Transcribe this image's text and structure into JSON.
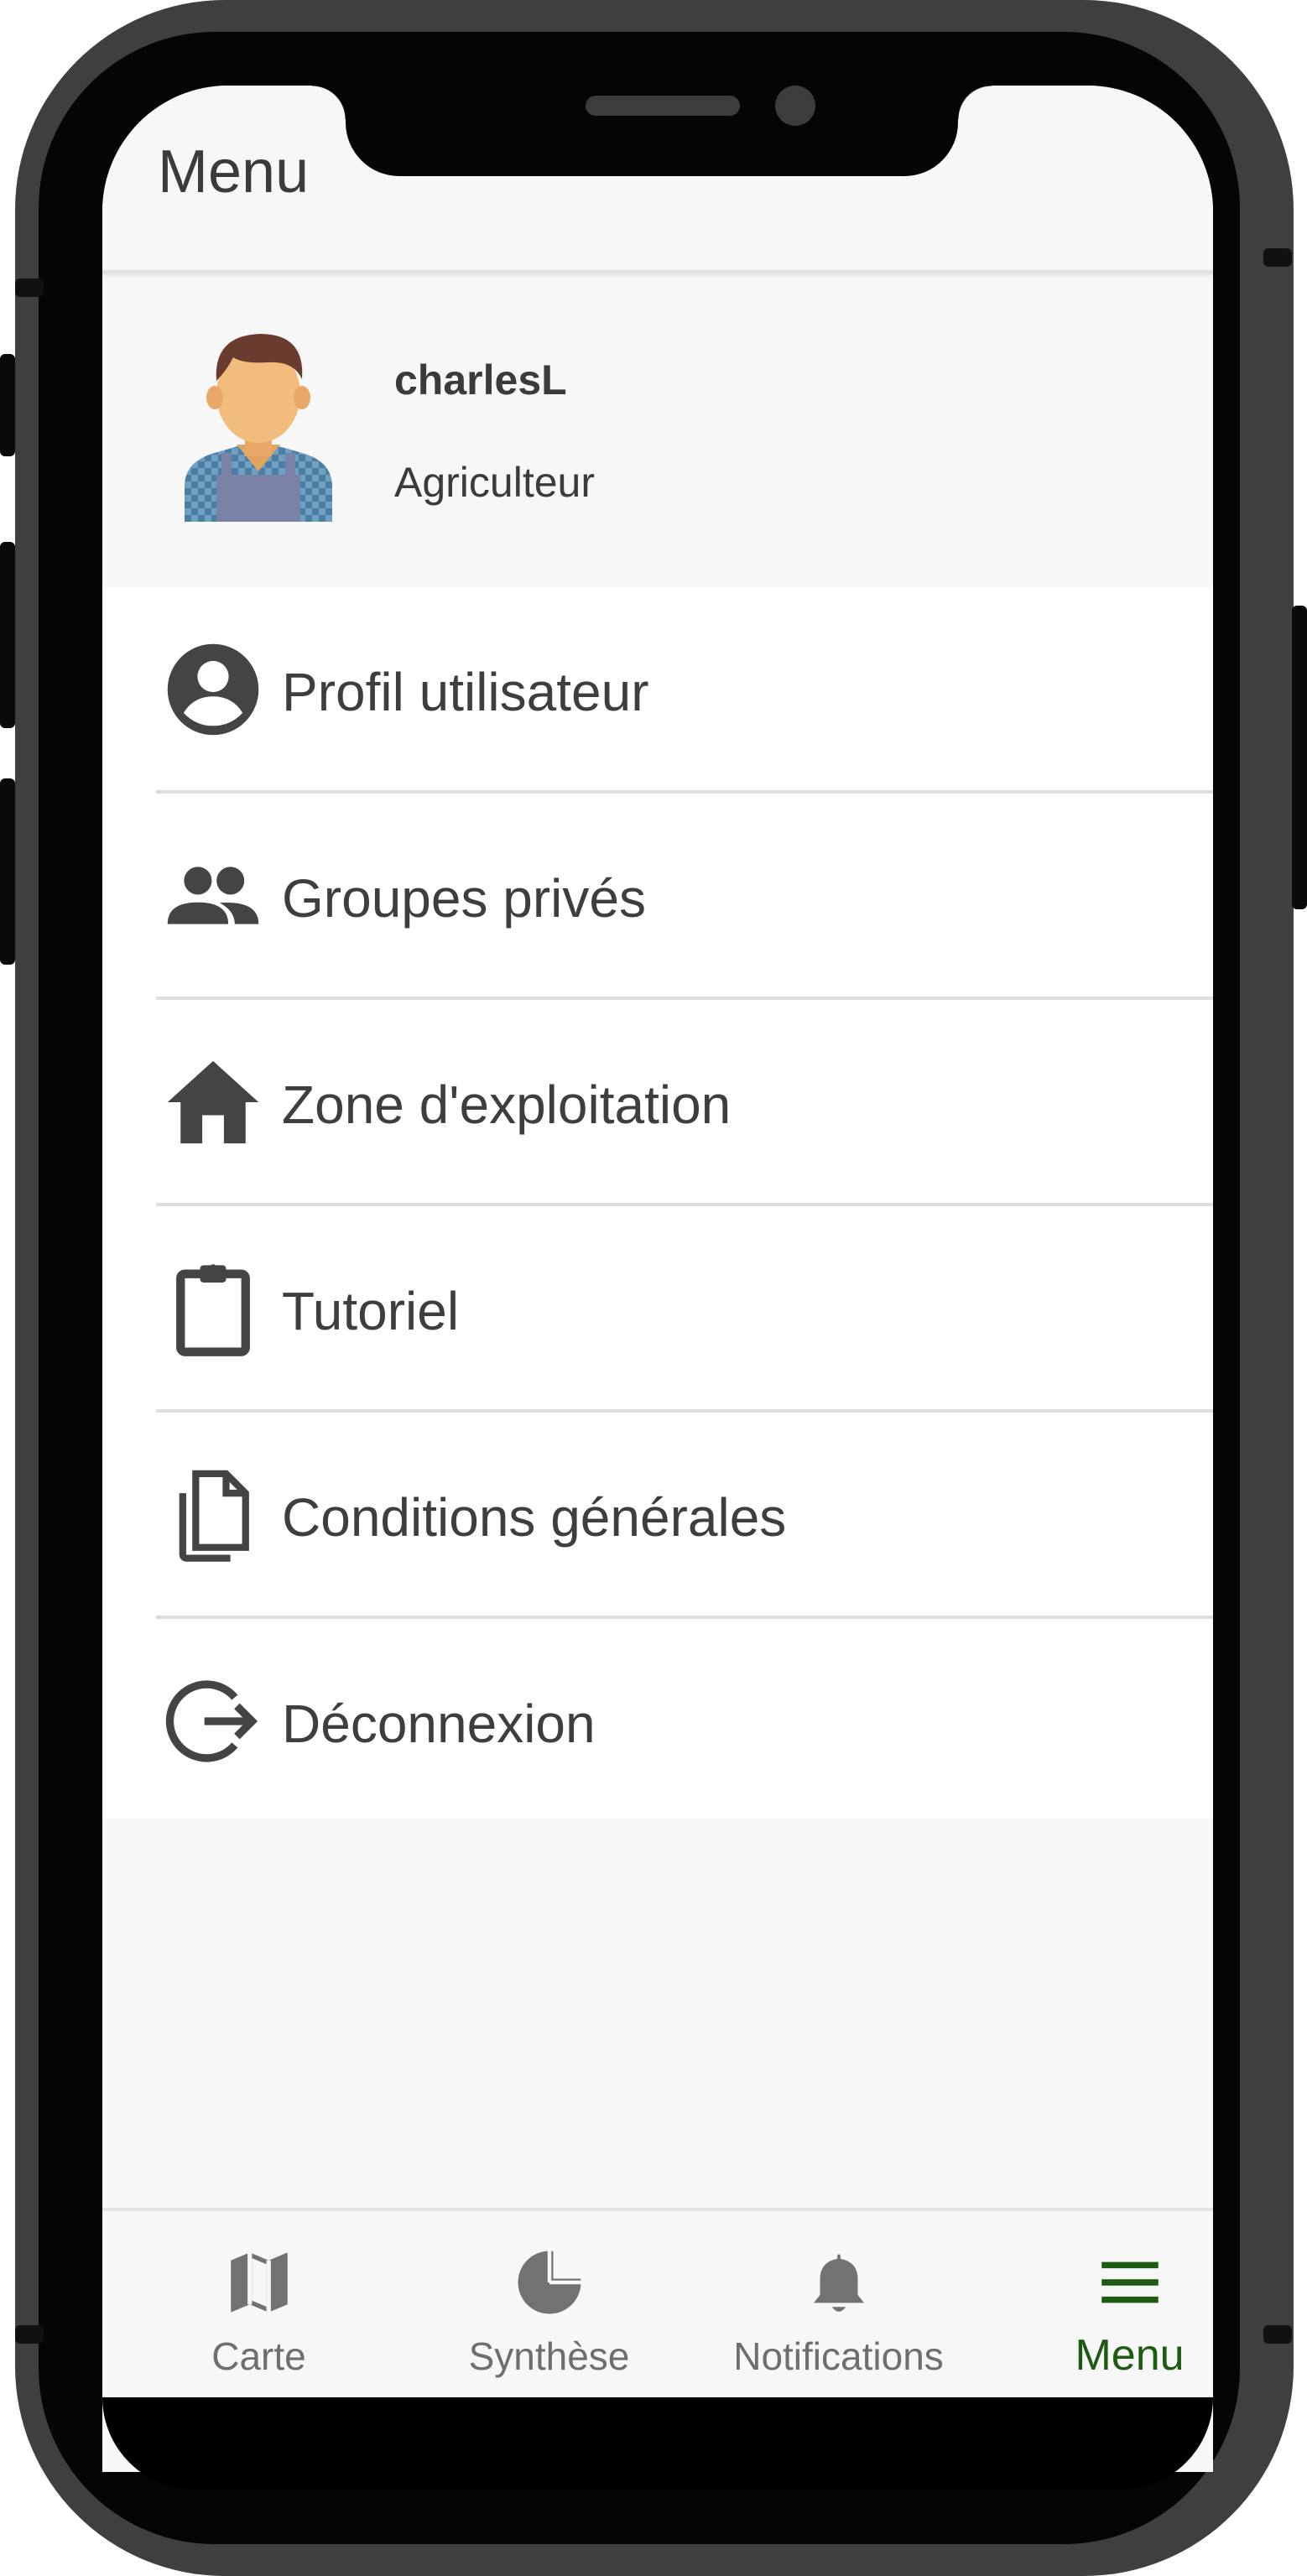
{
  "header": {
    "title": "Menu"
  },
  "profile": {
    "username": "charlesL",
    "role": "Agriculteur"
  },
  "menu": {
    "items": [
      {
        "label": "Profil utilisateur",
        "icon": "account-circle-icon"
      },
      {
        "label": "Groupes privés",
        "icon": "people-icon"
      },
      {
        "label": "Zone d'exploitation",
        "icon": "home-icon"
      },
      {
        "label": "Tutoriel",
        "icon": "clipboard-icon"
      },
      {
        "label": "Conditions générales",
        "icon": "documents-icon"
      },
      {
        "label": "Déconnexion",
        "icon": "logout-icon"
      }
    ]
  },
  "nav": {
    "items": [
      {
        "label": "Carte",
        "icon": "map-icon"
      },
      {
        "label": "Synthèse",
        "icon": "pie-chart-icon"
      },
      {
        "label": "Notifications",
        "icon": "bell-icon"
      },
      {
        "label": "Menu",
        "icon": "menu-icon",
        "active": true
      }
    ]
  },
  "colors": {
    "accent": "#1d5a12",
    "text": "#3e3e3e",
    "inactive": "#6e6e6e",
    "icon": "#444444"
  }
}
